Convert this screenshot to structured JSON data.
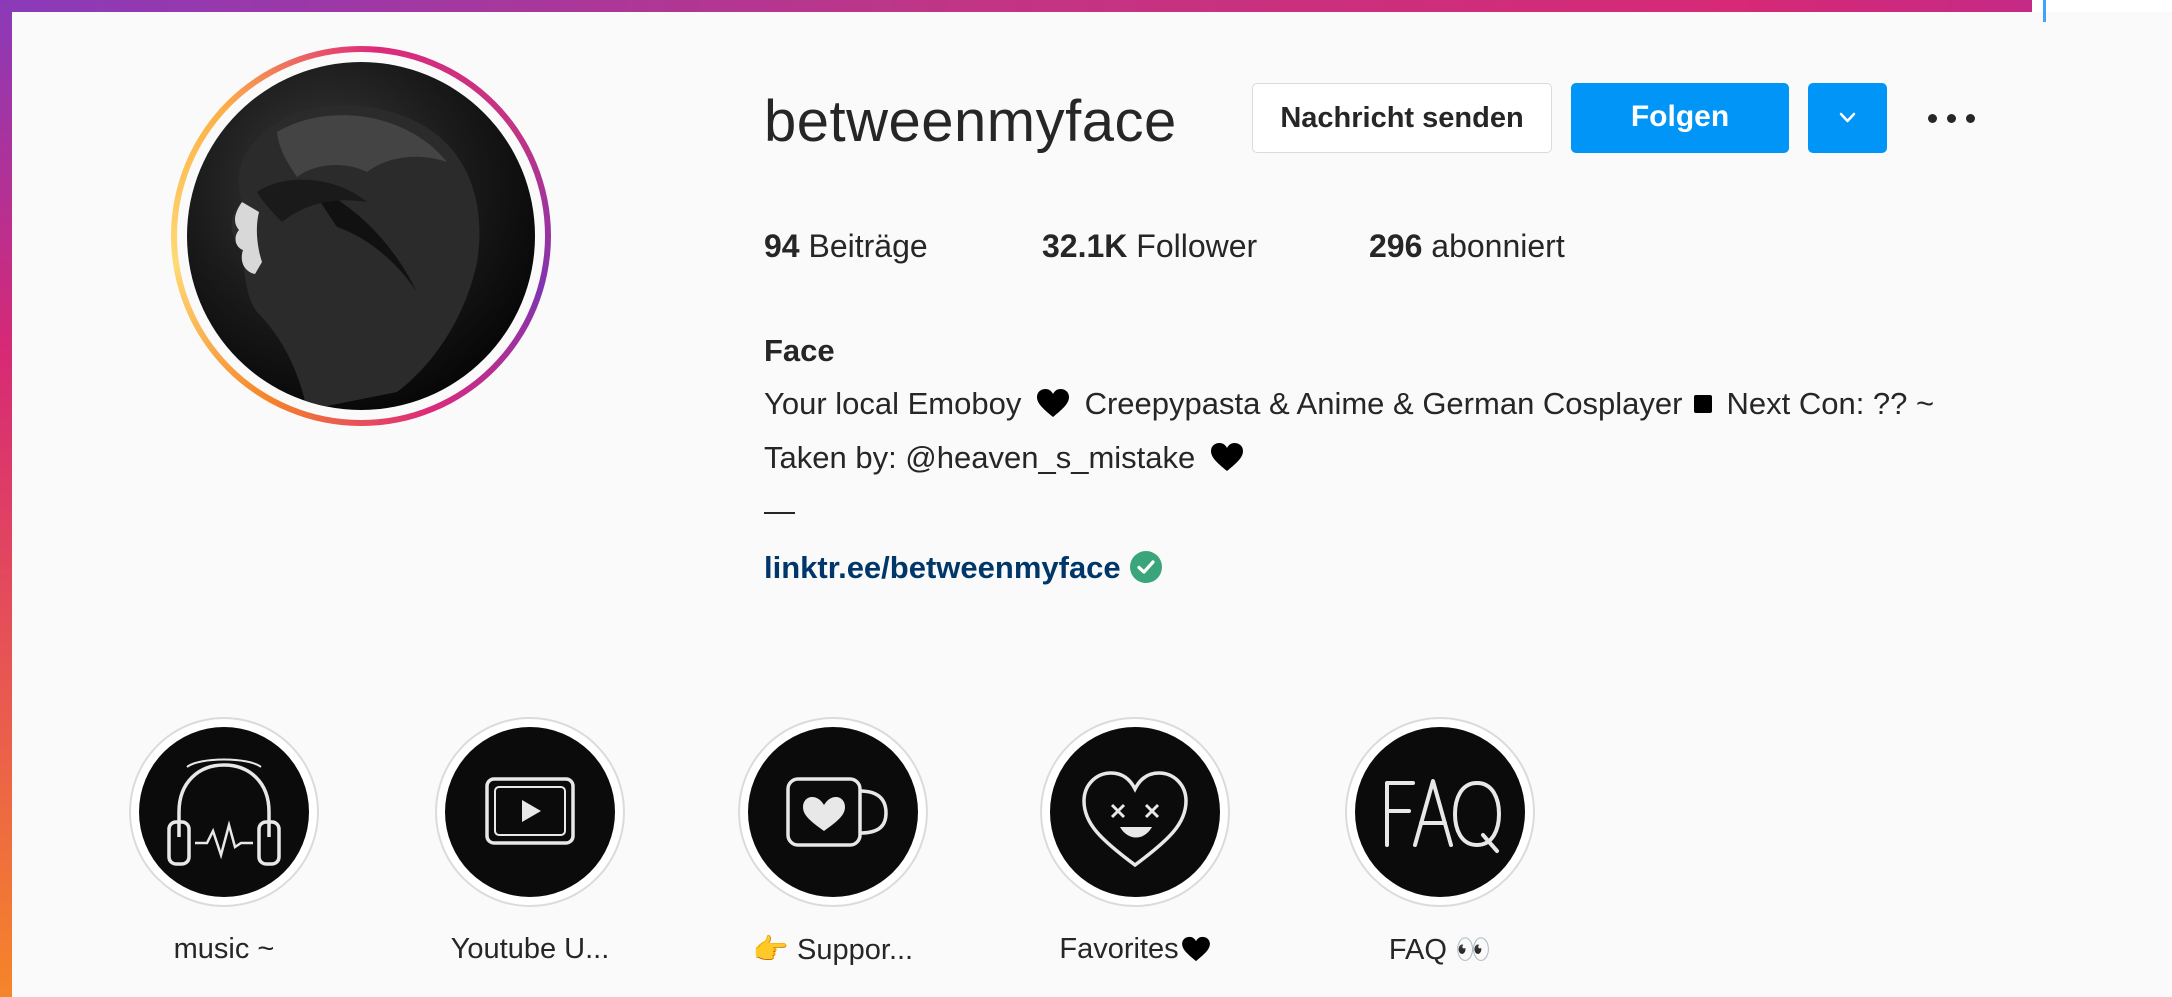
{
  "colors": {
    "accent": "#0095f6",
    "text": "#262626",
    "link": "#00376b",
    "verified": "#3aa57a"
  },
  "profile": {
    "username": "betweenmyface",
    "message_button": "Nachricht senden",
    "follow_button": "Folgen",
    "dropdown_icon": "chevron-down-icon",
    "more_icon": "more-horizontal-icon"
  },
  "stats": {
    "posts_count": "94",
    "posts_label": "Beiträge",
    "followers_count": "32.1K",
    "followers_label": "Follower",
    "following_count": "296",
    "following_label": "abonniert"
  },
  "bio": {
    "name": "Face",
    "line1_a": "Your local Emoboy",
    "line1_b": "Creepypasta & Anime & German Cosplayer",
    "line1_c": "Next Con: ?? ~",
    "line2": "Taken by: @heaven_s_mistake",
    "dash": "—",
    "link": "linktr.ee/betweenmyface"
  },
  "highlights": [
    {
      "label": "music ~",
      "icon": "headphones-icon"
    },
    {
      "label": "Youtube U...",
      "icon": "youtube-icon"
    },
    {
      "label": "Suppor...",
      "icon": "mug-heart-icon",
      "emoji": "👉"
    },
    {
      "label": "Favorites",
      "icon": "heart-face-icon"
    },
    {
      "label": "FAQ",
      "icon": "faq-icon",
      "emoji": "👀"
    }
  ]
}
